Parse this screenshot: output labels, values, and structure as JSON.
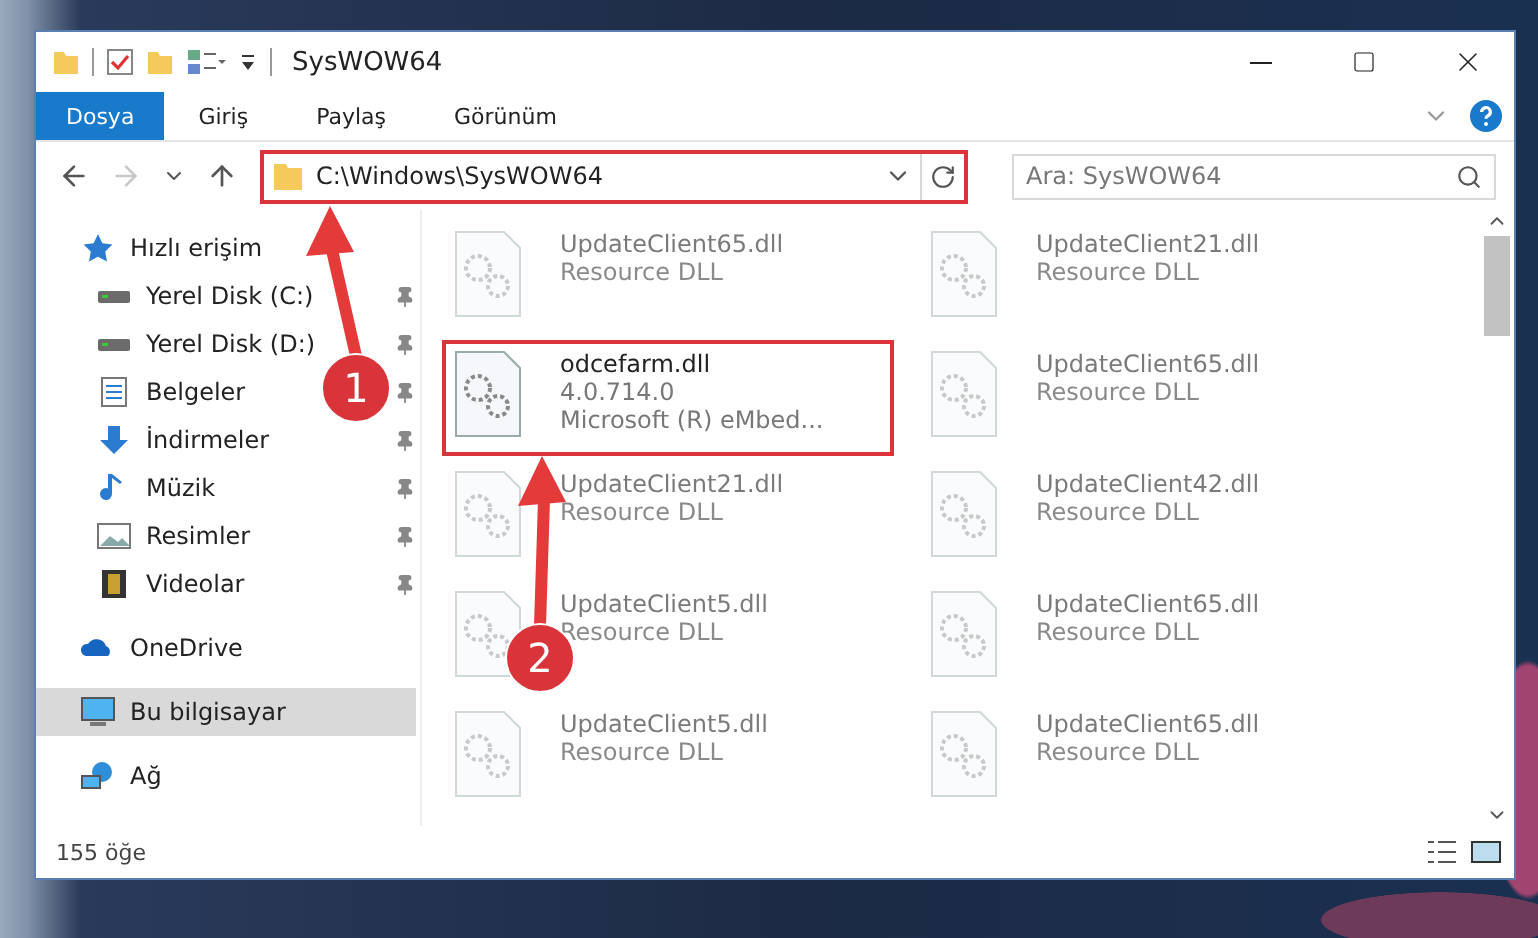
{
  "window": {
    "title": "SysWOW64"
  },
  "ribbon_tabs": [
    {
      "label": "Dosya",
      "selected": true
    },
    {
      "label": "Giriş",
      "selected": false
    },
    {
      "label": "Paylaş",
      "selected": false
    },
    {
      "label": "Görünüm",
      "selected": false
    }
  ],
  "address": {
    "path": "C:\\Windows\\SysWOW64",
    "highlighted": true
  },
  "search": {
    "placeholder": "Ara: SysWOW64"
  },
  "sidebar": {
    "items": [
      {
        "label": "Hızlı erişim",
        "kind": "star",
        "selected": false,
        "children": [
          {
            "label": "Yerel Disk (C:)",
            "kind": "drive",
            "pinned": true,
            "selected": false
          },
          {
            "label": "Yerel Disk (D:)",
            "kind": "drive",
            "pinned": true,
            "selected": false
          },
          {
            "label": "Belgeler",
            "kind": "document",
            "pinned": true,
            "selected": false
          },
          {
            "label": "İndirmeler",
            "kind": "download",
            "pinned": true,
            "selected": false
          },
          {
            "label": "Müzik",
            "kind": "music",
            "pinned": true,
            "selected": false
          },
          {
            "label": "Resimler",
            "kind": "image",
            "pinned": true,
            "selected": false
          },
          {
            "label": "Videolar",
            "kind": "video",
            "pinned": true,
            "selected": false
          }
        ]
      },
      {
        "label": "OneDrive",
        "kind": "cloud",
        "selected": false
      },
      {
        "label": "Bu bilgisayar",
        "kind": "computer",
        "selected": true
      },
      {
        "label": "Ağ",
        "kind": "network",
        "selected": false
      }
    ]
  },
  "files": [
    {
      "name": "UpdateClient65.dll",
      "details": [
        "Resource DLL"
      ],
      "dimmed": true,
      "highlighted": false
    },
    {
      "name": "UpdateClient21.dll",
      "details": [
        "Resource DLL"
      ],
      "dimmed": true,
      "highlighted": false
    },
    {
      "name": "odcefarm.dll",
      "details": [
        "4.0.714.0",
        "Microsoft (R) eMbed..."
      ],
      "dimmed": false,
      "highlighted": true
    },
    {
      "name": "UpdateClient65.dll",
      "details": [
        "Resource DLL"
      ],
      "dimmed": true,
      "highlighted": false
    },
    {
      "name": "UpdateClient21.dll",
      "details": [
        "Resource DLL"
      ],
      "dimmed": true,
      "highlighted": false
    },
    {
      "name": "UpdateClient42.dll",
      "details": [
        "Resource DLL"
      ],
      "dimmed": true,
      "highlighted": false
    },
    {
      "name": "UpdateClient5.dll",
      "details": [
        "Resource DLL"
      ],
      "dimmed": true,
      "highlighted": false
    },
    {
      "name": "UpdateClient65.dll",
      "details": [
        "Resource DLL"
      ],
      "dimmed": true,
      "highlighted": false
    },
    {
      "name": "UpdateClient5.dll",
      "details": [
        "Resource DLL"
      ],
      "dimmed": true,
      "highlighted": false
    },
    {
      "name": "UpdateClient65.dll",
      "details": [
        "Resource DLL"
      ],
      "dimmed": true,
      "highlighted": false
    }
  ],
  "status_bar": {
    "count": "155 öğe"
  },
  "annotations": [
    {
      "number": "1"
    },
    {
      "number": "2"
    }
  ]
}
